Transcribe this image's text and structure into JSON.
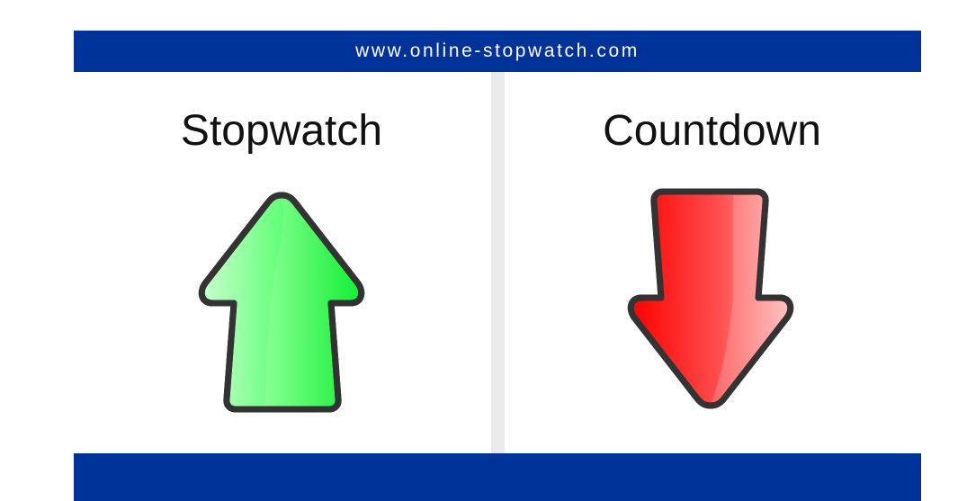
{
  "header": {
    "url_text": "www.online-stopwatch.com"
  },
  "panels": {
    "stopwatch": {
      "title": "Stopwatch",
      "icon": "arrow-up-icon"
    },
    "countdown": {
      "title": "Countdown",
      "icon": "arrow-down-icon"
    }
  },
  "colors": {
    "brand_blue": "#003399",
    "divider_gray": "#ebebeb",
    "up_arrow_green": "#11ee33",
    "down_arrow_red": "#ff1111",
    "arrow_outline": "#333333"
  }
}
